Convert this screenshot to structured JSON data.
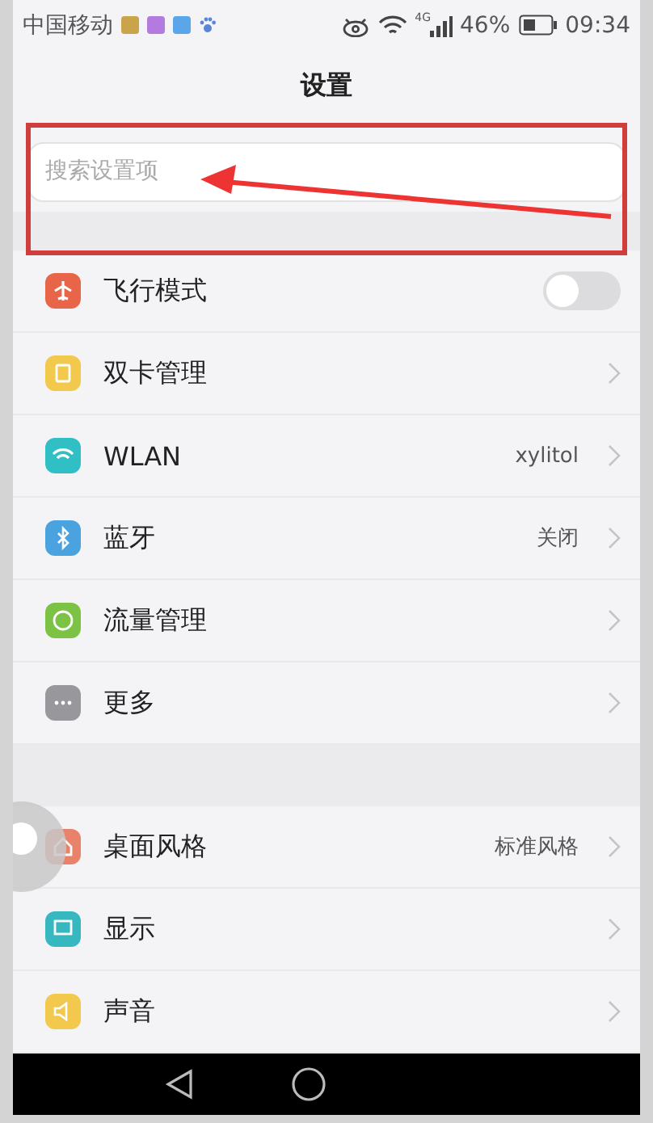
{
  "status_bar": {
    "carrier": "中国移动",
    "network": "4G",
    "battery": "46%",
    "time": "09:34"
  },
  "title": "设置",
  "search": {
    "placeholder": "搜索设置项"
  },
  "groups": [
    {
      "items": [
        {
          "kind": "switch",
          "label": "飞行模式",
          "on": false
        },
        {
          "kind": "link",
          "label": "双卡管理"
        },
        {
          "kind": "link",
          "label": "WLAN",
          "value": "xylitol"
        },
        {
          "kind": "link",
          "label": "蓝牙",
          "value": "关闭"
        },
        {
          "kind": "link",
          "label": "流量管理"
        },
        {
          "kind": "link",
          "label": "更多"
        }
      ]
    },
    {
      "items": [
        {
          "kind": "link",
          "label": "桌面风格",
          "value": "标准风格"
        },
        {
          "kind": "link",
          "label": "显示"
        },
        {
          "kind": "link",
          "label": "声音"
        }
      ]
    }
  ]
}
